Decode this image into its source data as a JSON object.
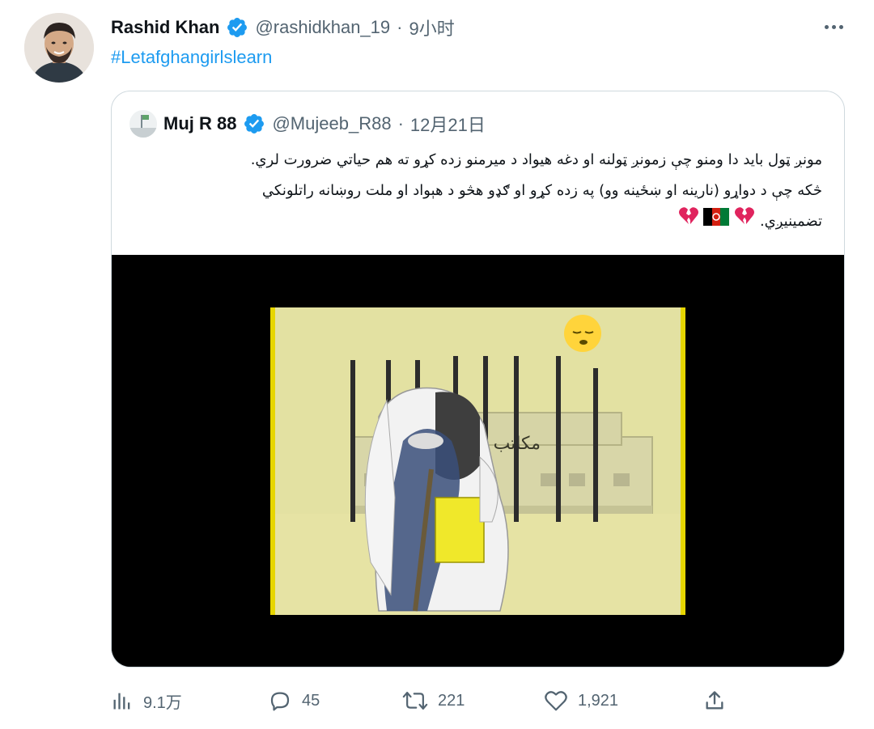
{
  "tweet": {
    "display_name": "Rashid Khan",
    "handle": "@rashidkhan_19",
    "separator": "·",
    "time": "9小时",
    "hashtag": "#Letafghangirlslearn"
  },
  "quote": {
    "display_name": "Muj R 88",
    "handle": "@Mujeeb_R88",
    "separator": "·",
    "time": "12月21日",
    "text_line1": "مونږ ټول باید دا ومنو چې زمونږ ټولنه او دغه هیواد د میرمنو زده کړو ته هم حیاتي ضرورت لري.",
    "text_line2": "څکه چې د دواړو (نارینه او ښځینه وو) په زده کړو او ګډو هڅو د هېواد او ملت روښانه راتلونکي",
    "text_line3": "تضمینیږي.",
    "emojis": [
      "broken-heart-emoji",
      "afghanistan-flag-emoji",
      "broken-heart-emoji"
    ],
    "image_sign_text": "مکاتب"
  },
  "actions": {
    "views": "9.1万",
    "replies": "45",
    "retweets": "221",
    "likes": "1,921"
  },
  "colors": {
    "accent": "#1d9bf0",
    "secondary_text": "#536471",
    "border": "#cfd9de",
    "broken_heart": "#e0245e",
    "artwork_background": "#e3e1a2"
  }
}
